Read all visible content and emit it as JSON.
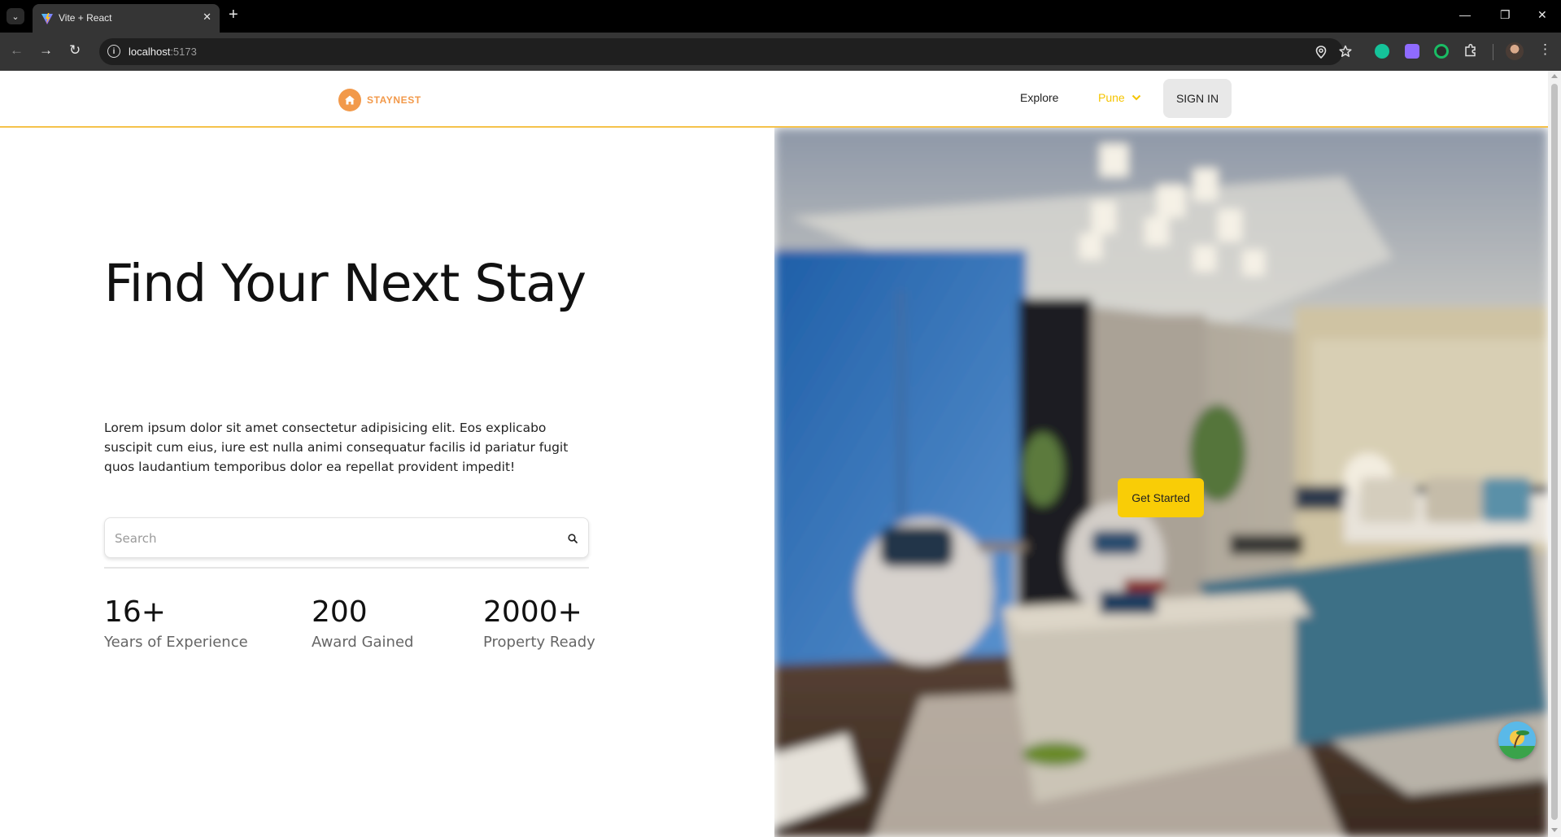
{
  "browser": {
    "tab_title": "Vite + React",
    "url_host": "localhost",
    "url_port": ":5173"
  },
  "navbar": {
    "logo_text": "STAYNEST",
    "explore_label": "Explore",
    "city_label": "Pune",
    "signin_label": "SIGN IN"
  },
  "hero": {
    "title": "Find Your Next Stay",
    "description": "Lorem ipsum dolor sit amet consectetur adipisicing elit. Eos explicabo suscipit cum eius, iure est nulla animi consequatur facilis id pariatur fugit quos laudantium temporibus dolor ea repellat provident impedit!",
    "search_placeholder": "Search",
    "cta_label": "Get Started",
    "stats": [
      {
        "value": "16+",
        "label": "Years of Experience"
      },
      {
        "value": "200",
        "label": "Award Gained"
      },
      {
        "value": "2000+",
        "label": "Property Ready"
      }
    ]
  },
  "colors": {
    "accent": "#f9cd06",
    "brand": "#f2994a",
    "navbar_border": "#f5c24b"
  },
  "icons": [
    "tab-search-icon",
    "vite-favicon",
    "close-icon",
    "plus-icon",
    "back-arrow-icon",
    "forward-arrow-icon",
    "reload-icon",
    "site-info-icon",
    "location-icon",
    "star-icon",
    "grammarly-icon",
    "extension-icon",
    "puzzle-icon",
    "more-icon",
    "home-icon",
    "chevron-down-icon",
    "search-icon"
  ]
}
